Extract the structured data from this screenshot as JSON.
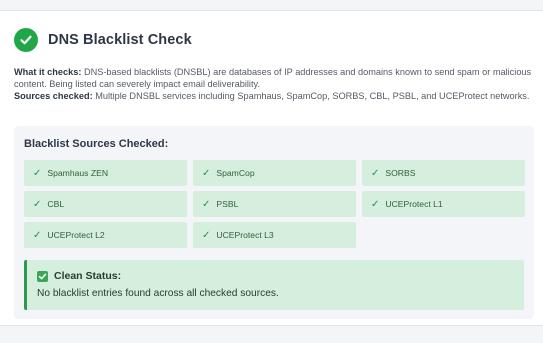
{
  "header": {
    "title": "DNS Blacklist Check",
    "icon": "check-circle-icon",
    "accent": "#22a64a"
  },
  "description": {
    "what_label": "What it checks:",
    "what_text": "DNS-based blacklists (DNSBL) are databases of IP addresses and domains known to send spam or malicious content. Being listed can severely impact email deliverability.",
    "sources_label": "Sources checked:",
    "sources_text": "Multiple DNSBL services including Spamhaus, SpamCop, SORBS, CBL, PSBL, and UCEProtect networks."
  },
  "sources": {
    "title": "Blacklist Sources Checked:",
    "check_glyph": "✓",
    "items": [
      {
        "label": "Spamhaus ZEN"
      },
      {
        "label": "SpamCop"
      },
      {
        "label": "SORBS"
      },
      {
        "label": "CBL"
      },
      {
        "label": "PSBL"
      },
      {
        "label": "UCEProtect L1"
      },
      {
        "label": "UCEProtect L2"
      },
      {
        "label": "UCEProtect L3"
      }
    ]
  },
  "status": {
    "title": "Clean Status:",
    "message": "No blacklist entries found across all checked sources.",
    "icon": "checkbox-icon",
    "color": "#d6eedd"
  }
}
